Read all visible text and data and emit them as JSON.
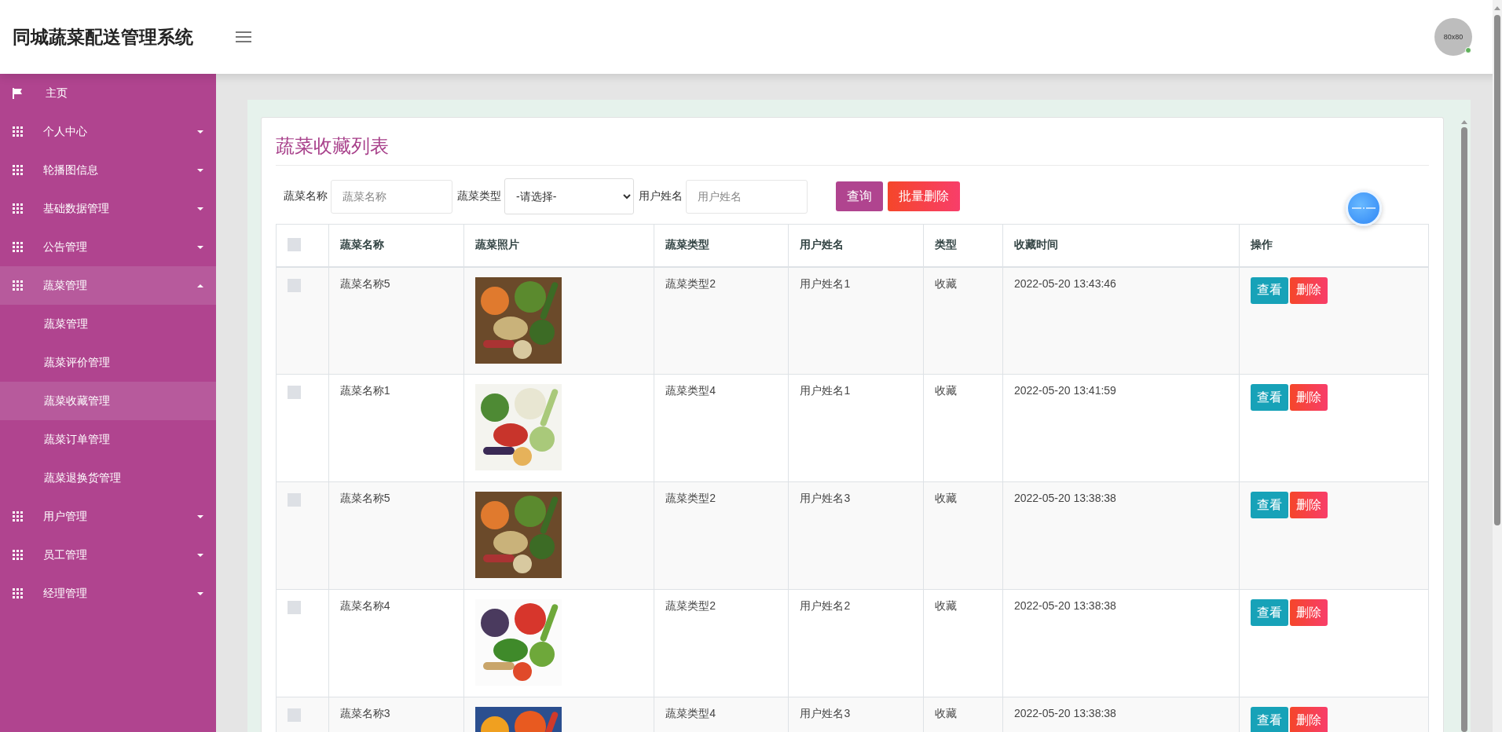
{
  "header": {
    "title": "同城蔬菜配送管理系统",
    "avatar_text": "80x80",
    "online": true
  },
  "sidebar": {
    "items": [
      {
        "kind": "link",
        "label": "主页"
      },
      {
        "kind": "menu",
        "label": "个人中心",
        "expanded": false
      },
      {
        "kind": "menu",
        "label": "轮播图信息",
        "expanded": false
      },
      {
        "kind": "menu",
        "label": "基础数据管理",
        "expanded": false
      },
      {
        "kind": "menu",
        "label": "公告管理",
        "expanded": false
      },
      {
        "kind": "menu",
        "label": "蔬菜管理",
        "expanded": true,
        "children": [
          {
            "label": "蔬菜管理",
            "selected": false
          },
          {
            "label": "蔬菜评价管理",
            "selected": false
          },
          {
            "label": "蔬菜收藏管理",
            "selected": true
          },
          {
            "label": "蔬菜订单管理",
            "selected": false
          },
          {
            "label": "蔬菜退换货管理",
            "selected": false
          }
        ]
      },
      {
        "kind": "menu",
        "label": "用户管理",
        "expanded": false
      },
      {
        "kind": "menu",
        "label": "员工管理",
        "expanded": false
      },
      {
        "kind": "menu",
        "label": "经理管理",
        "expanded": false
      }
    ]
  },
  "page_title": "蔬菜收藏列表",
  "filters": [
    {
      "kind": "input",
      "label": "蔬菜名称",
      "placeholder": "蔬菜名称"
    },
    {
      "kind": "select",
      "label": "蔬菜类型",
      "value": "-请选择-"
    },
    {
      "kind": "input",
      "label": "用户姓名",
      "placeholder": "用户姓名"
    }
  ],
  "actions": [
    {
      "kind": "search",
      "label": "查询"
    },
    {
      "kind": "bulk-delete",
      "label": "批量删除"
    }
  ],
  "table": {
    "all_checked": false,
    "columns": [
      "蔬菜名称",
      "蔬菜照片",
      "蔬菜类型",
      "用户姓名",
      "类型",
      "收藏时间",
      "操作"
    ],
    "rows": [
      {
        "checked": false,
        "name": "蔬菜名称5",
        "photo": {
          "kind": "picture"
        },
        "veg_type": "蔬菜类型2",
        "user": "用户姓名1",
        "type": "收藏",
        "time": "2022-05-20 13:43:46",
        "buttons": [
          "查看",
          "删除"
        ]
      },
      {
        "checked": false,
        "name": "蔬菜名称1",
        "photo": {
          "kind": "picture"
        },
        "veg_type": "蔬菜类型4",
        "user": "用户姓名1",
        "type": "收藏",
        "time": "2022-05-20 13:41:59",
        "buttons": [
          "查看",
          "删除"
        ]
      },
      {
        "checked": false,
        "name": "蔬菜名称5",
        "photo": {
          "kind": "picture"
        },
        "veg_type": "蔬菜类型2",
        "user": "用户姓名3",
        "type": "收藏",
        "time": "2022-05-20 13:38:38",
        "buttons": [
          "查看",
          "删除"
        ]
      },
      {
        "checked": false,
        "name": "蔬菜名称4",
        "photo": {
          "kind": "picture"
        },
        "veg_type": "蔬菜类型2",
        "user": "用户姓名2",
        "type": "收藏",
        "time": "2022-05-20 13:38:38",
        "buttons": [
          "查看",
          "删除"
        ]
      },
      {
        "checked": false,
        "name": "蔬菜名称3",
        "photo": {
          "kind": "picture"
        },
        "veg_type": "蔬菜类型4",
        "user": "用户姓名3",
        "type": "收藏",
        "time": "2022-05-20 13:38:38",
        "buttons": [
          "查看",
          "删除"
        ]
      }
    ]
  }
}
